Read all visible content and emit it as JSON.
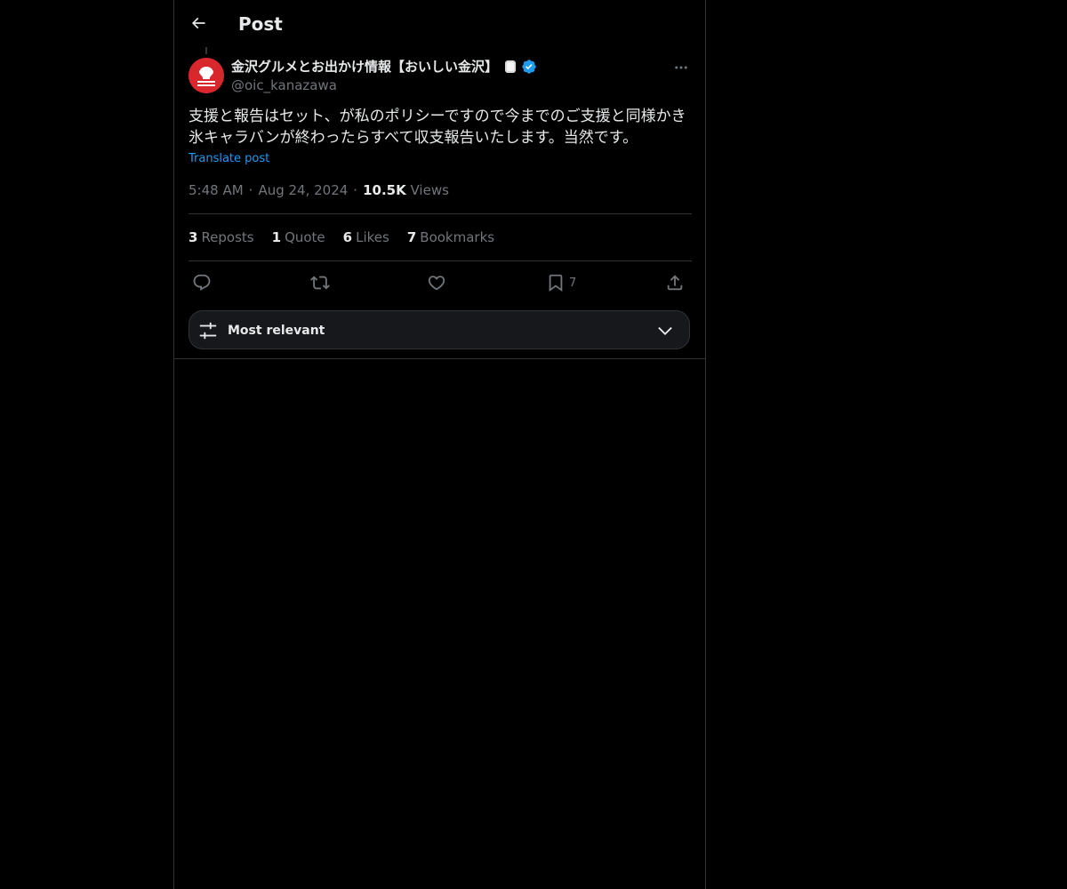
{
  "header": {
    "title": "Post",
    "back_icon": "arrow-left-icon"
  },
  "post": {
    "author": {
      "name": "金沢グルメとお出かけ情報【おいしい金沢】",
      "handle": "@oic_kanazawa",
      "avatar_color": "#d8272d",
      "verified": true,
      "badge_icon": "shaved-ice-emoji-icon",
      "verified_icon": "verified-badge-icon"
    },
    "text": "支援と報告はセット、が私のポリシーですので今までのご支援と同様かき氷キャラバンが終わったらすべて収支報告いたします。当然です。",
    "translate_label": "Translate post",
    "time": "5:48 AM",
    "date": "Aug 24, 2024",
    "views_count": "10.5K",
    "views_label": "Views",
    "separator": "·",
    "stats": [
      {
        "count": "3",
        "label": "Reposts"
      },
      {
        "count": "1",
        "label": "Quote"
      },
      {
        "count": "6",
        "label": "Likes"
      },
      {
        "count": "7",
        "label": "Bookmarks"
      }
    ],
    "actions": {
      "reply_icon": "reply-icon",
      "repost_icon": "repost-icon",
      "like_icon": "heart-icon",
      "bookmark_icon": "bookmark-icon",
      "bookmark_count": "7",
      "share_icon": "share-icon"
    }
  },
  "sort": {
    "label": "Most relevant",
    "icon": "sliders-icon",
    "chevron_icon": "chevron-down-icon"
  },
  "colors": {
    "background": "#000000",
    "text": "#e7e9ea",
    "muted": "#71767b",
    "accent": "#1d9bf0",
    "border": "#2f3336"
  }
}
